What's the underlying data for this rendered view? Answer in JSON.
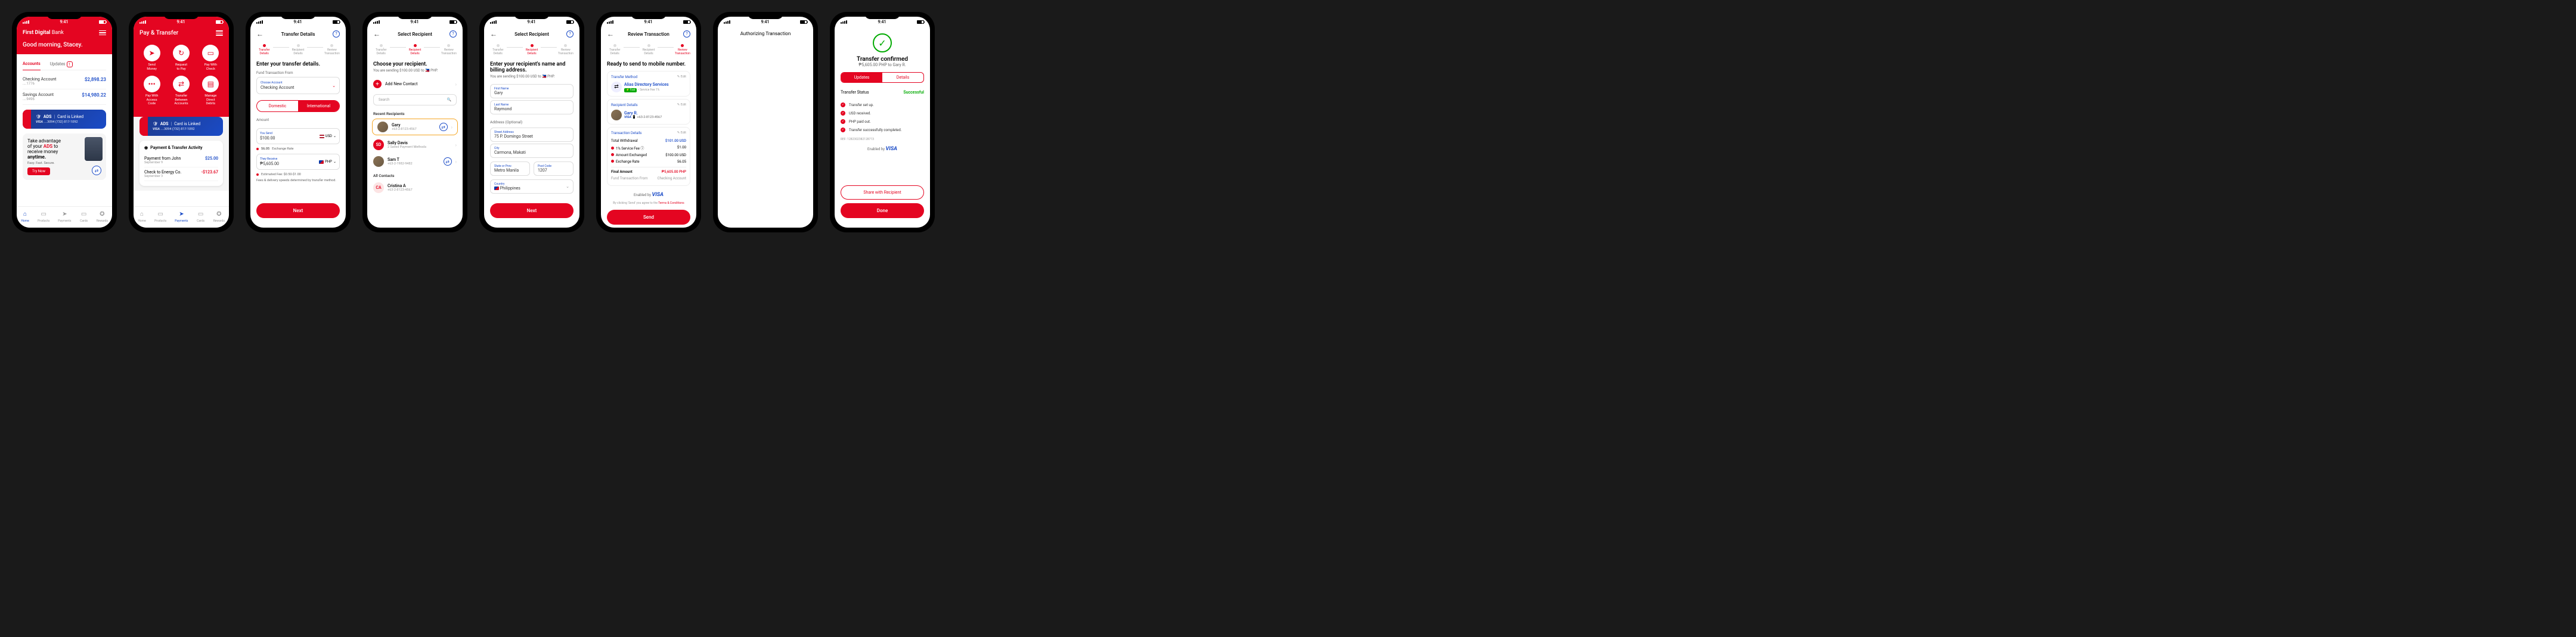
{
  "status": {
    "time": "9:41"
  },
  "s1": {
    "brand_bold": "First Digital",
    "brand_rest": " Bank",
    "greeting": "Good morning, Stacey.",
    "tabs": {
      "accounts": "Accounts",
      "updates": "Updates",
      "badge": "1"
    },
    "accounts": [
      {
        "name": "Checking Account",
        "mask": "....1776",
        "amt": "$2,898.23"
      },
      {
        "name": "Savings Account",
        "mask": "....9496",
        "amt": "$14,980.22"
      }
    ],
    "ads": {
      "title": "ADS",
      "linked": "Card is Linked",
      "card": "....3094",
      "phone": "(732) 817-1092"
    },
    "promo": {
      "l1": "Take advantage",
      "l2": "of your ",
      "hl": "ADS",
      "l3": " to",
      "l4": "receive money",
      "l5": "anytime.",
      "sub": "Easy. Fast. Secure.",
      "btn": "Try Now"
    },
    "nav": [
      "Home",
      "Products",
      "Payments",
      "Cards",
      "Rewards"
    ]
  },
  "s2": {
    "title": "Pay & Transfer",
    "icons": [
      "Send\nMoney",
      "Request\nto Pay",
      "Pay With\nCheck",
      "Pay With\nAccess\nCode",
      "Transfer\nBetween\nAccounts",
      "Manage\nDirect\nDebits"
    ],
    "activity_title": "Payment & Transfer Activity",
    "activity": [
      {
        "name": "Payment from John",
        "date": "September 9",
        "amt": "$25.00"
      },
      {
        "name": "Check to Energy Co.",
        "date": "September 3",
        "amt": "-$123.67"
      }
    ]
  },
  "s3": {
    "title": "Transfer Details",
    "steps": [
      "Transfer\nDetails",
      "Recipient\nDetails",
      "Review\nTransaction"
    ],
    "head": "Enter your transfer details.",
    "fund_label": "Fund Transaction From",
    "choose": "Choose Account",
    "acct": "Checking Account",
    "seg": {
      "domestic": "Domestic",
      "intl": "International"
    },
    "amount_label": "Amount",
    "send_label": "You Send",
    "send_val": "$100.00",
    "send_cur": "USD",
    "rate": "56.05",
    "rate_label": "Exchange Rate",
    "recv_label": "They Receive",
    "recv_val": "₱5,605.00",
    "recv_cur": "PHP",
    "fee": "Estimated Fee: $0.50-$1.00",
    "fee_sub": "Fees & delivery speeds determined by transfer method.",
    "next": "Next"
  },
  "s4": {
    "title": "Select Recipient",
    "head": "Choose your recipient.",
    "sub": "You are sending $100.00 USD to 🇵🇭 PHP.",
    "add": "Add New Contact",
    "search": "Search",
    "recent": "Recent Recipients",
    "contacts": "All Contacts",
    "list": [
      {
        "name": "Gary",
        "sub": "+63-2-8123-4567",
        "selected": true,
        "alias": true
      },
      {
        "name": "Sally Davis",
        "sub": "2 Saved Payment Methods",
        "initials": "SD"
      },
      {
        "name": "Sam T",
        "sub": "+63-2-1982-9482",
        "alias": true
      }
    ],
    "all": [
      {
        "name": "Cristina A",
        "sub": "+63-2-8123-4567",
        "initials": "CA"
      }
    ]
  },
  "s5": {
    "title": "Select Recipient",
    "head": "Enter your recipient's name and billing address.",
    "sub": "You are sending $100.00 USD to 🇵🇭 PHP.",
    "fields": {
      "first_name": {
        "label": "First Name",
        "value": "Gary"
      },
      "last_name": {
        "label": "Last Name",
        "value": "Raymond"
      },
      "address": {
        "section": "Address (Optional)",
        "street_label": "Street Address",
        "street": "75 P. Domingo Street"
      },
      "city": {
        "label": "City",
        "value": "Carmona, Makati"
      },
      "state": {
        "label": "State or Prov.",
        "value": "Metro Manila"
      },
      "post": {
        "label": "Post Code",
        "value": "1207"
      },
      "country": {
        "label": "Country",
        "value": "Philippines"
      }
    },
    "next": "Next"
  },
  "s6": {
    "title": "Review Transaction",
    "head": "Ready to send to mobile number.",
    "method": {
      "label": "Transfer Method",
      "name": "Alias Directory Services",
      "fast": "Fast",
      "fee": "Service Fee 1%",
      "edit": "Edit"
    },
    "recipient": {
      "label": "Recipient Details",
      "name": "Gary R.",
      "phone": "+63-2-8123-4567",
      "edit": "Edit"
    },
    "txn": {
      "label": "Transaction Details",
      "edit": "Edit",
      "rows": [
        {
          "k": "Total Withdrawal",
          "v": "$101.00 USD"
        },
        {
          "k": "1% Service Fee",
          "v": "$1.00",
          "red": true
        },
        {
          "k": "Amount Exchanged",
          "v": "$100.00 USD",
          "red": true
        },
        {
          "k": "Exchange Rate",
          "v": "56.05",
          "red": true
        }
      ],
      "final_k": "Final Amount",
      "final_v": "₱5,605.00 PHP",
      "from_k": "Fund Transaction From",
      "from_v": "Checking Account"
    },
    "enabled": "Enabled by",
    "visa": "VISA",
    "terms_pre": "By clicking 'Send' you agree to the ",
    "terms_link": "Terms & Conditions",
    "send": "Send"
  },
  "s7": {
    "title": "Authorizing Transaction"
  },
  "s8": {
    "title": "Transfer confirmed",
    "sub": "₱5,605.00 PHP to Gary R.",
    "tabs": {
      "updates": "Updates",
      "details": "Details"
    },
    "status_label": "Transfer Status",
    "status_val": "Successful",
    "timeline": [
      "Transfer set up.",
      "USD received.",
      "PHP paid out.",
      "Transfer successfully completed."
    ],
    "ref_label": "REF:",
    "ref": "1282302382128713",
    "enabled": "Enabled by",
    "visa": "VISA",
    "share": "Share with Recipient",
    "done": "Done"
  }
}
